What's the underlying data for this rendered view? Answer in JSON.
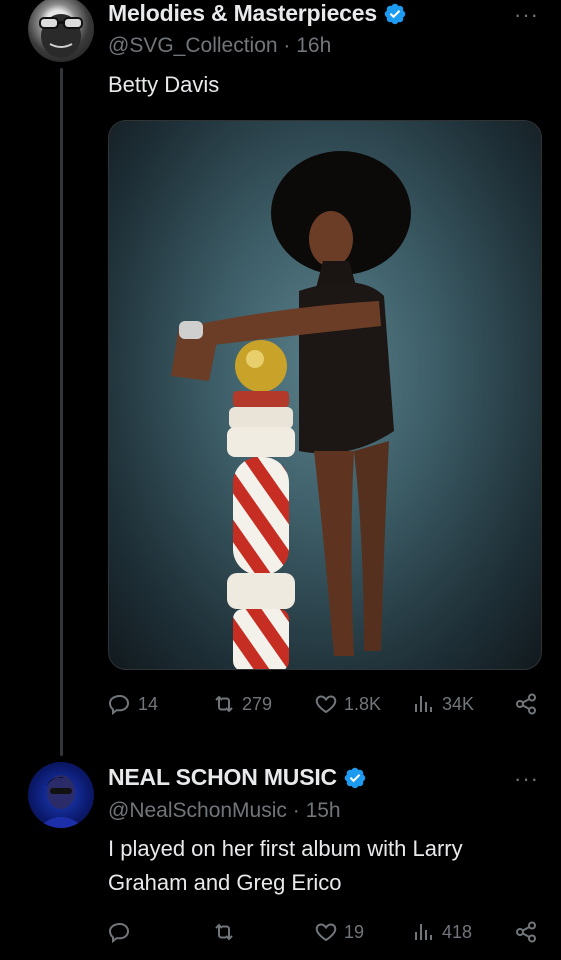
{
  "tweet1": {
    "author_name": "Melodies & Masterpieces",
    "handle": "@SVG_Collection",
    "time": "16h",
    "text": "Betty Davis",
    "more_label": "···",
    "stats": {
      "replies": "14",
      "retweets": "279",
      "likes": "1.8K",
      "views": "34K"
    }
  },
  "tweet2": {
    "author_name": "NEAL SCHON MUSIC",
    "handle": "@NealSchonMusic",
    "time": "15h",
    "text": "I played on her first album with Larry Graham and Greg Erico",
    "more_label": "···",
    "stats": {
      "replies": "",
      "retweets": "",
      "likes": "19",
      "views": "418"
    }
  },
  "colors": {
    "background": "#000000",
    "primary_text": "#e7e9ea",
    "secondary_text": "#71767b",
    "verified": "#1d9bf0",
    "thread_line": "#333639"
  },
  "icons": [
    "reply-icon",
    "retweet-icon",
    "like-icon",
    "views-icon",
    "share-icon",
    "verified-icon",
    "more-icon"
  ]
}
